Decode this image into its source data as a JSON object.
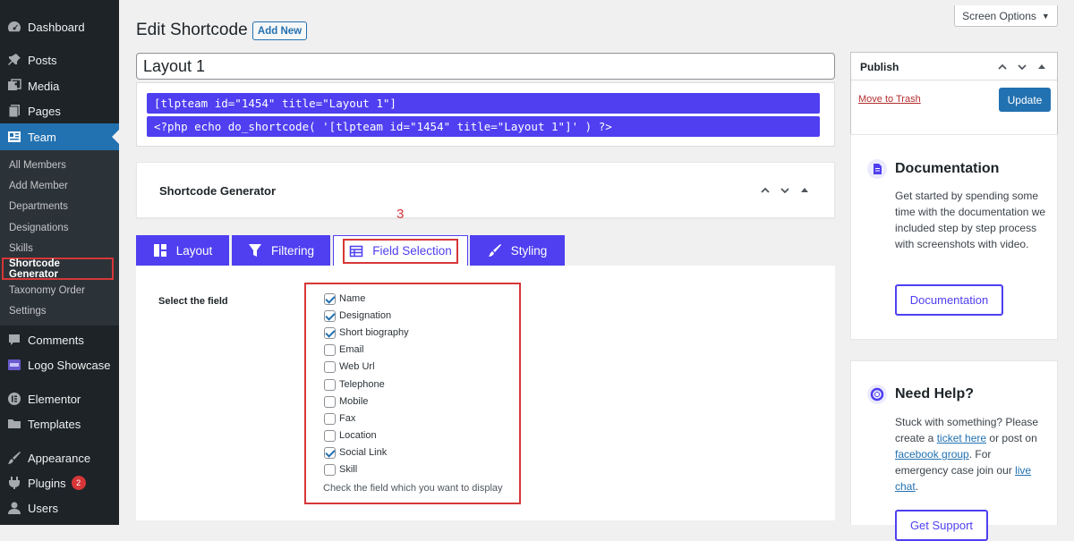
{
  "sidebar": {
    "top_items": [
      {
        "label": "Dashboard",
        "icon": "dashboard-icon"
      },
      {
        "label": "Posts",
        "icon": "pin-icon"
      },
      {
        "label": "Media",
        "icon": "media-icon"
      },
      {
        "label": "Pages",
        "icon": "page-icon"
      },
      {
        "label": "Team",
        "icon": "team-icon"
      }
    ],
    "team_submenu": [
      "All Members",
      "Add Member",
      "Departments",
      "Designations",
      "Skills",
      "Shortcode Generator",
      "Taxonomy Order",
      "Settings"
    ],
    "bottom_items": [
      {
        "label": "Comments",
        "icon": "comment-icon"
      },
      {
        "label": "Logo Showcase",
        "icon": "logo-showcase-icon"
      },
      {
        "label": "Elementor",
        "icon": "elementor-icon"
      },
      {
        "label": "Templates",
        "icon": "folder-icon"
      },
      {
        "label": "Appearance",
        "icon": "brush-icon"
      },
      {
        "label": "Plugins",
        "icon": "plugin-icon",
        "badge": "2"
      },
      {
        "label": "Users",
        "icon": "user-icon"
      }
    ]
  },
  "screen_options": {
    "label": "Screen Options"
  },
  "header": {
    "title": "Edit Shortcode",
    "add_new": "Add New"
  },
  "title_input": {
    "value": "Layout 1"
  },
  "shortcodes": {
    "line1": "[tlpteam id=\"1454\" title=\"Layout 1\"]",
    "line2": "<?php echo do_shortcode( '[tlpteam id=\"1454\" title=\"Layout 1\"]' ) ?>"
  },
  "generator": {
    "title": "Shortcode Generator",
    "annotation": "3",
    "tabs": [
      {
        "label": "Layout",
        "icon": "layout-icon"
      },
      {
        "label": "Filtering",
        "icon": "filter-icon"
      },
      {
        "label": "Field Selection",
        "icon": "table-icon"
      },
      {
        "label": "Styling",
        "icon": "brush-icon"
      }
    ],
    "field_label": "Select the field",
    "fields": [
      {
        "label": "Name",
        "checked": true
      },
      {
        "label": "Designation",
        "checked": true
      },
      {
        "label": "Short biography",
        "checked": true
      },
      {
        "label": "Email",
        "checked": false
      },
      {
        "label": "Web Url",
        "checked": false
      },
      {
        "label": "Telephone",
        "checked": false
      },
      {
        "label": "Mobile",
        "checked": false
      },
      {
        "label": "Fax",
        "checked": false
      },
      {
        "label": "Location",
        "checked": false
      },
      {
        "label": "Social Link",
        "checked": true
      },
      {
        "label": "Skill",
        "checked": false
      }
    ],
    "help_text": "Check the field which you want to display"
  },
  "publish": {
    "title": "Publish",
    "trash": "Move to Trash",
    "update": "Update"
  },
  "documentation": {
    "title": "Documentation",
    "text": "Get started by spending some time with the documentation we included step by step process with screenshots with video.",
    "button": "Documentation"
  },
  "need_help": {
    "title": "Need Help?",
    "text_1": "Stuck with something? Please create a ",
    "link_1": "ticket here",
    "text_2": " or post on ",
    "link_2": "facebook group",
    "text_3": ". For emergency case join our ",
    "link_3": "live chat",
    "text_4": ".",
    "button": "Get Support"
  },
  "colors": {
    "accent": "#4f3ff0",
    "wp_blue": "#2271b1",
    "sidebar": "#1d2327",
    "annotation_red": "#d63638"
  }
}
